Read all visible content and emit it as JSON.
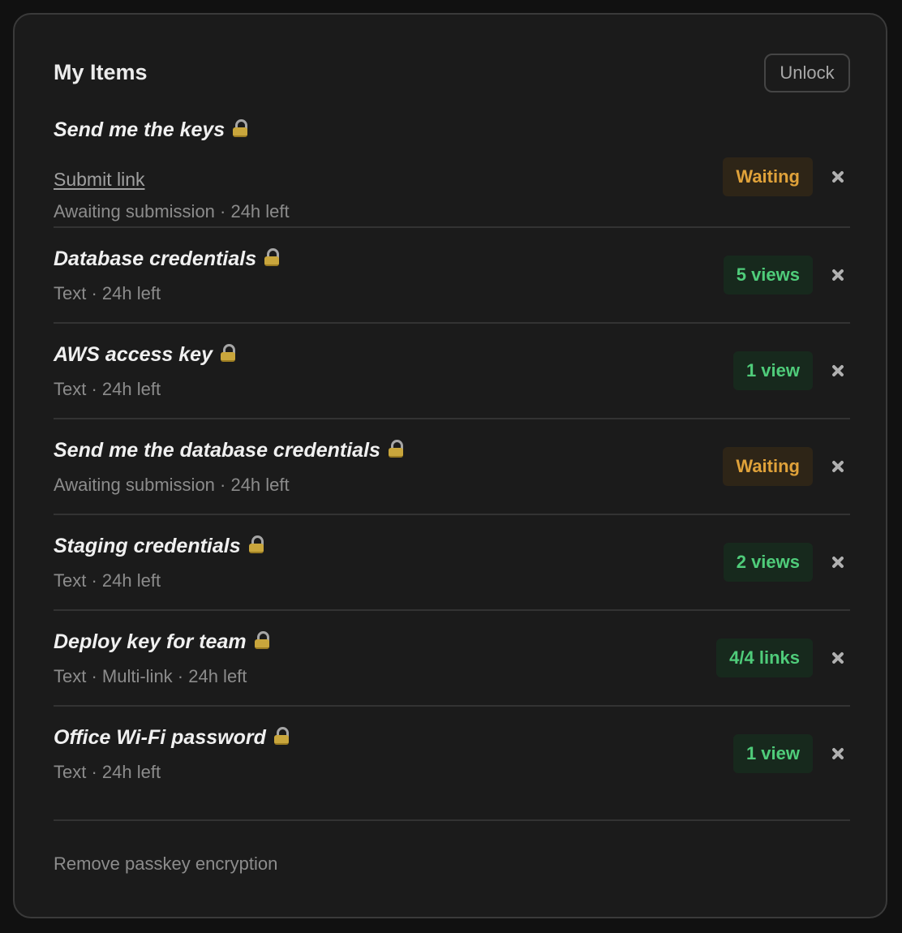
{
  "header": {
    "title": "My Items",
    "unlock_label": "Unlock"
  },
  "items": [
    {
      "title": "Send me the keys",
      "link_label": "Submit link",
      "meta": "Awaiting submission · 24h left",
      "badge": "Waiting",
      "badge_status": "waiting"
    },
    {
      "title": "Database credentials",
      "meta": "Text · 24h left",
      "badge": "5 views",
      "badge_status": "views"
    },
    {
      "title": "AWS access key",
      "meta": "Text · 24h left",
      "badge": "1 view",
      "badge_status": "views"
    },
    {
      "title": "Send me the database credentials",
      "meta": "Awaiting submission · 24h left",
      "badge": "Waiting",
      "badge_status": "waiting"
    },
    {
      "title": "Staging credentials",
      "meta": "Text · 24h left",
      "badge": "2 views",
      "badge_status": "views"
    },
    {
      "title": "Deploy key for team",
      "meta": "Text · Multi-link · 24h left",
      "badge": "4/4 links",
      "badge_status": "views"
    },
    {
      "title": "Office Wi-Fi password",
      "meta": "Text · 24h left",
      "badge": "1 view",
      "badge_status": "views"
    }
  ],
  "footer": {
    "remove_label": "Remove passkey encryption"
  },
  "colors": {
    "waiting_text": "#e0a23a",
    "waiting_bg": "#2e2517",
    "views_text": "#4fcc7a",
    "views_bg": "#17291d"
  },
  "icons": {
    "lock": "lock-icon",
    "close": "close-icon"
  }
}
